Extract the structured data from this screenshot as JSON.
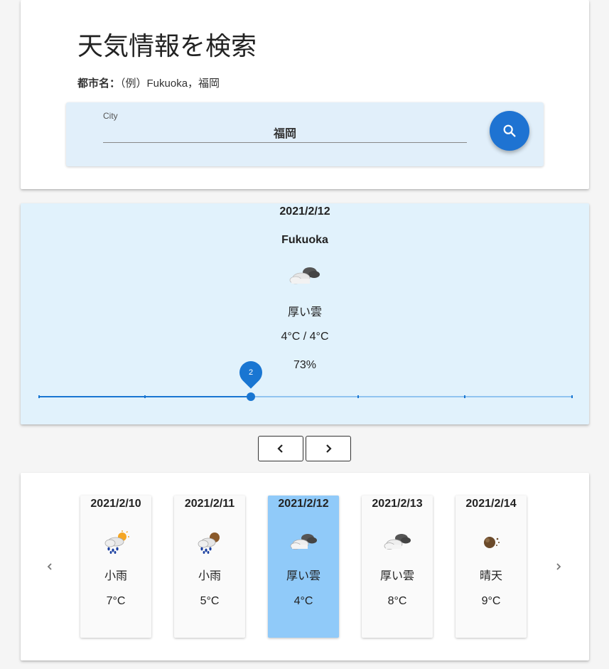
{
  "search": {
    "title": "天気情報を検索",
    "hint_label": "都市名：",
    "hint_example": "（例）Fukuoka，福岡",
    "field_label": "City",
    "field_value": "福岡",
    "button_icon": "search-icon"
  },
  "detail": {
    "date": "2021/2/12",
    "city": "Fukuoka",
    "icon": "cloud-icon",
    "condition": "厚い雲",
    "temperature": "4°C / 4°C",
    "humidity": "73%",
    "slider_value": "2",
    "slider_min": 0,
    "slider_max": 5
  },
  "nav": {
    "prev_icon": "chevron-left-icon",
    "next_icon": "chevron-right-icon"
  },
  "forecast": {
    "prev_icon": "chevron-left-icon",
    "next_icon": "chevron-right-icon",
    "days": [
      {
        "date": "2021/2/10",
        "icon": "rain-sun-icon",
        "condition": "小雨",
        "temp": "7°C",
        "selected": false
      },
      {
        "date": "2021/2/11",
        "icon": "rain-moon-icon",
        "condition": "小雨",
        "temp": "5°C",
        "selected": false
      },
      {
        "date": "2021/2/12",
        "icon": "cloud-icon",
        "condition": "厚い雲",
        "temp": "4°C",
        "selected": true
      },
      {
        "date": "2021/2/13",
        "icon": "cloud-icon",
        "condition": "厚い雲",
        "temp": "8°C",
        "selected": false
      },
      {
        "date": "2021/2/14",
        "icon": "moon-icon",
        "condition": "晴天",
        "temp": "9°C",
        "selected": false
      }
    ]
  },
  "colors": {
    "accent": "#1976d2",
    "search_bar_bg": "#e1effa",
    "detail_bg": "#e1f2fc",
    "selected_day_bg": "#90caf9"
  }
}
